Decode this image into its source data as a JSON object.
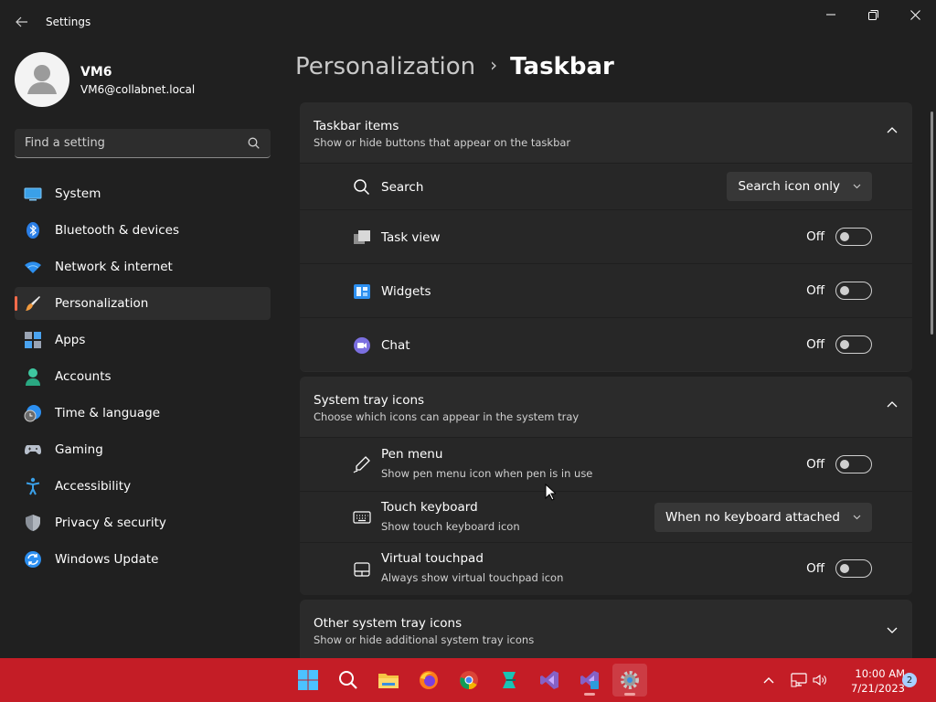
{
  "window": {
    "title": "Settings"
  },
  "profile": {
    "name": "VM6",
    "email": "VM6@collabnet.local"
  },
  "search": {
    "placeholder": "Find a setting"
  },
  "nav": {
    "items": [
      {
        "label": "System",
        "icon": "system-icon"
      },
      {
        "label": "Bluetooth & devices",
        "icon": "bluetooth-icon"
      },
      {
        "label": "Network & internet",
        "icon": "wifi-icon"
      },
      {
        "label": "Personalization",
        "icon": "brush-icon",
        "selected": true
      },
      {
        "label": "Apps",
        "icon": "apps-icon"
      },
      {
        "label": "Accounts",
        "icon": "accounts-icon"
      },
      {
        "label": "Time & language",
        "icon": "globe-clock-icon"
      },
      {
        "label": "Gaming",
        "icon": "gamepad-icon"
      },
      {
        "label": "Accessibility",
        "icon": "accessibility-icon"
      },
      {
        "label": "Privacy & security",
        "icon": "shield-icon"
      },
      {
        "label": "Windows Update",
        "icon": "update-icon"
      }
    ]
  },
  "breadcrumb": {
    "parent": "Personalization",
    "separator": "›",
    "current": "Taskbar"
  },
  "sections": {
    "taskbar_items": {
      "title": "Taskbar items",
      "subtitle": "Show or hide buttons that appear on the taskbar",
      "rows": {
        "search": {
          "label": "Search",
          "value": "Search icon only"
        },
        "task_view": {
          "label": "Task view",
          "state": "Off"
        },
        "widgets": {
          "label": "Widgets",
          "state": "Off"
        },
        "chat": {
          "label": "Chat",
          "state": "Off"
        }
      }
    },
    "system_tray": {
      "title": "System tray icons",
      "subtitle": "Choose which icons can appear in the system tray",
      "rows": {
        "pen_menu": {
          "label": "Pen menu",
          "desc": "Show pen menu icon when pen is in use",
          "state": "Off"
        },
        "touch_keyboard": {
          "label": "Touch keyboard",
          "desc": "Show touch keyboard icon",
          "value": "When no keyboard attached"
        },
        "virtual_touchpad": {
          "label": "Virtual touchpad",
          "desc": "Always show virtual touchpad icon",
          "state": "Off"
        }
      }
    },
    "other_tray": {
      "title": "Other system tray icons",
      "subtitle": "Show or hide additional system tray icons"
    }
  },
  "taskbar": {
    "apps": [
      "start-icon",
      "search-icon",
      "file-explorer-icon",
      "firefox-icon",
      "chrome-icon",
      "app-icon",
      "visual-studio-icon",
      "visual-studio-2-icon",
      "settings-icon"
    ],
    "clock": {
      "time": "10:00 AM",
      "date": "7/21/2023"
    },
    "notification_count": "2"
  },
  "colors": {
    "accent": "#ff6b4a",
    "taskbar": "#c41d26",
    "background": "#202020",
    "card": "#2b2b2b"
  }
}
